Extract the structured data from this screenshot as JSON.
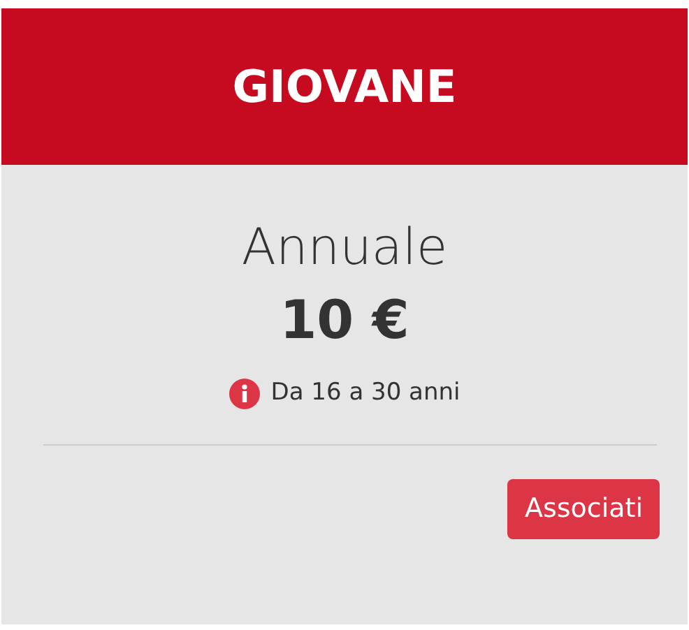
{
  "plan": {
    "title": "GIOVANE",
    "period": "Annuale",
    "price": "10 €",
    "note": "Da 16 a 30 anni",
    "button": "Associati"
  }
}
